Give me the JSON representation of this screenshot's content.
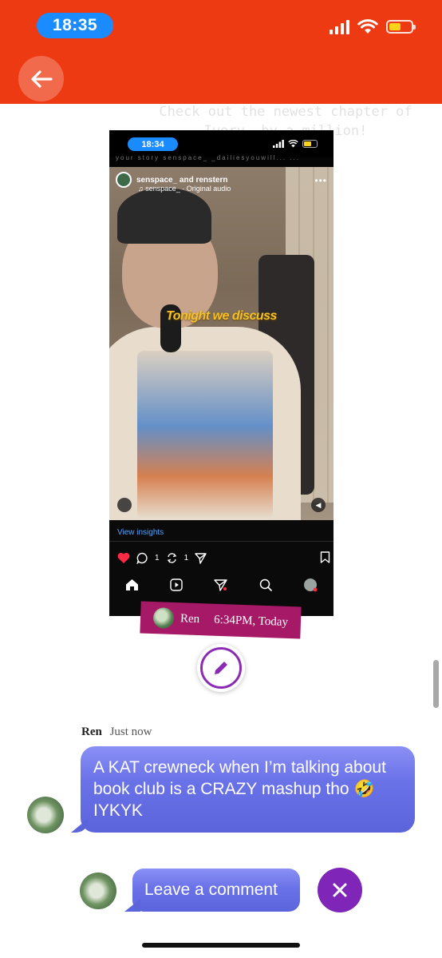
{
  "status_bar": {
    "time": "18:35"
  },
  "header": {
    "back_icon": "arrow-left-icon",
    "background": "#ee3a12"
  },
  "ghost_text": "Check out the newest chapter of Ivory, by a million!",
  "post_screenshot": {
    "status_time": "18:34",
    "stories_strip": "your story   senspace_   _dailiesyouwill...   ...",
    "username": "senspace_ and renstern",
    "audio": "♫ senspace_ · Original audio",
    "caption": "Tonight we discuss",
    "insights_label": "View insights",
    "comment_count": "1",
    "repost_count": "1"
  },
  "tag": {
    "name": "Ren",
    "timestamp": "6:34PM, Today",
    "color": "#a51966"
  },
  "comment": {
    "author": "Ren",
    "time": "Just now",
    "text": "A KAT crewneck when I’m talking about book club is a CRAZY mashup tho 🤣 IYKYK"
  },
  "composer": {
    "placeholder": "Leave a comment"
  },
  "colors": {
    "accent_purple": "#7f26b8",
    "bubble": "#6a72e8"
  }
}
